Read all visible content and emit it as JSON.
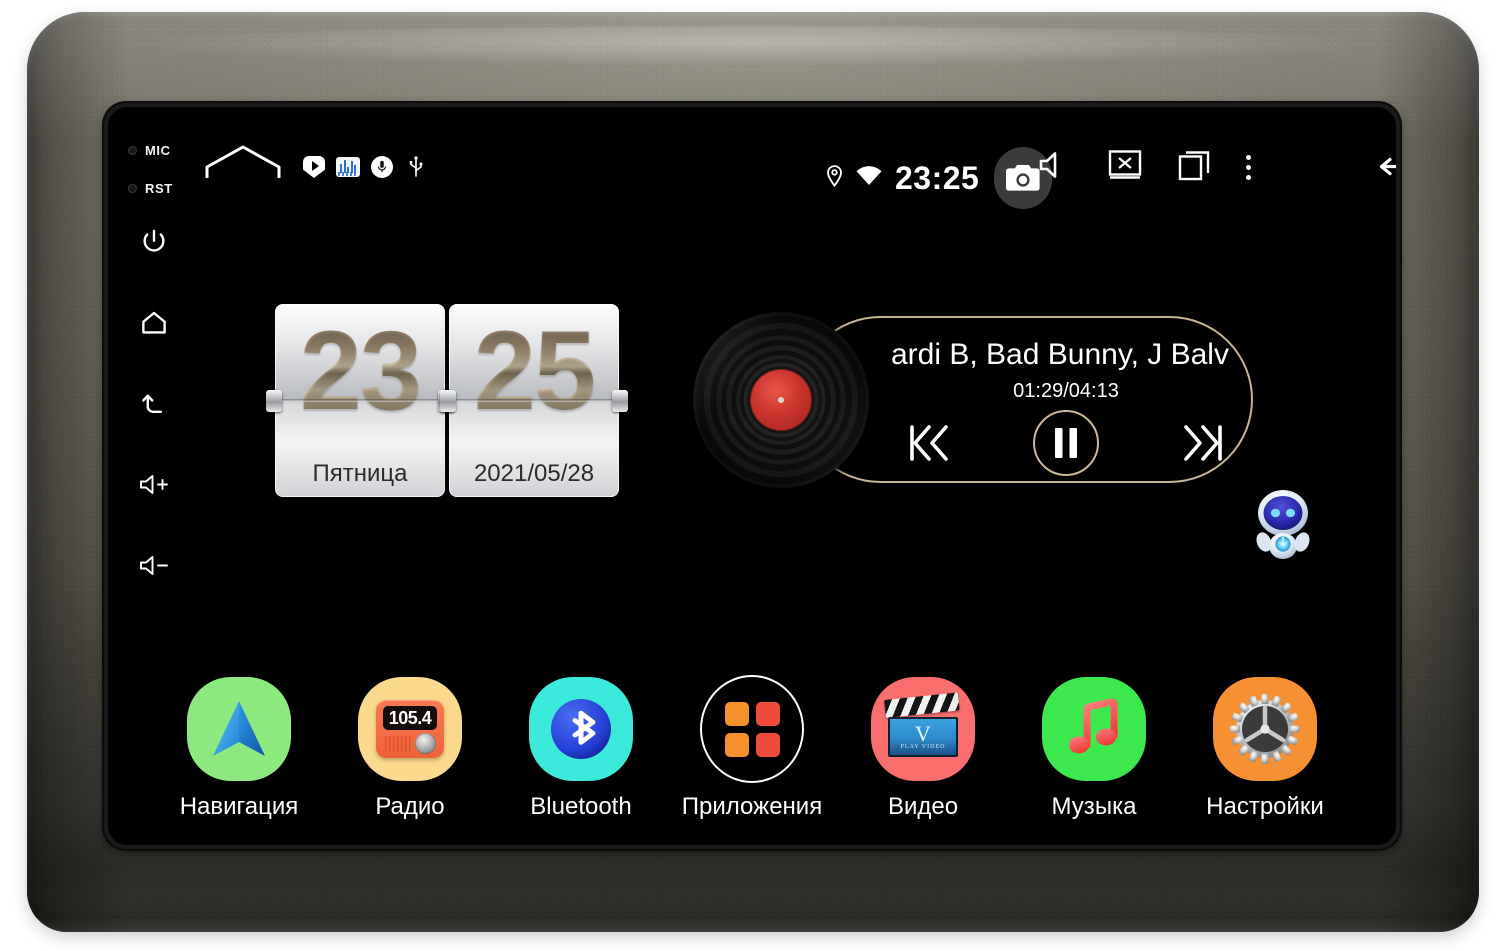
{
  "device": {
    "name": "Android car head unit",
    "bezel_color": "#6f6c61",
    "screen_bg": "#000000"
  },
  "indicators": [
    {
      "label": "MIC",
      "name": "mic-indicator"
    },
    {
      "label": "RST",
      "name": "reset-indicator"
    }
  ],
  "hardkeys": [
    {
      "icon": "power-icon",
      "label": "Power"
    },
    {
      "icon": "home-icon",
      "label": "Home"
    },
    {
      "icon": "back-icon",
      "label": "Back"
    },
    {
      "icon": "volume-up-icon",
      "label": "Volume +"
    },
    {
      "icon": "volume-down-icon",
      "label": "Volume -"
    }
  ],
  "statusbar": {
    "home_icon": "home-outline-icon",
    "notifications": [
      {
        "icon": "play-shield-icon",
        "label": "Player"
      },
      {
        "icon": "equalizer-icon",
        "label": "MP3 equalizer"
      },
      {
        "icon": "microphone-icon",
        "label": "Voice assistant"
      },
      {
        "icon": "usb-icon",
        "label": "USB connected"
      }
    ],
    "location_icon": "location-pin-icon",
    "wifi_icon": "wifi-icon",
    "time": "23:25",
    "camera_icon": "camera-icon",
    "camera_active": true,
    "volume_icon": "speaker-mute-icon",
    "screen_off_icon": "screen-off-icon",
    "recents_icon": "recent-apps-icon",
    "overflow_icon": "more-vertical-icon",
    "back_icon": "back-arrow-icon"
  },
  "clock_widget": {
    "hours": "23",
    "minutes": "25",
    "weekday": "Пятница",
    "date": "2021/05/28"
  },
  "player_widget": {
    "album_art": "vinyl-record",
    "track_title": "ardi B, Bad Bunny, J Balv",
    "elapsed": "01:29",
    "duration": "04:13",
    "time_display": "01:29/04:13",
    "prev_icon": "previous-track-icon",
    "play_pause_icon": "pause-icon",
    "next_icon": "next-track-icon",
    "state": "playing",
    "accent_color": "#c8b496"
  },
  "assistant": {
    "icon": "robot-assistant-icon",
    "label": "Voice assistant robot"
  },
  "dock": {
    "apps": [
      {
        "label": "Навигация",
        "icon": "navigation-icon",
        "bg": "#8ce87f",
        "name": "app-navigation"
      },
      {
        "label": "Радио",
        "icon": "radio-icon",
        "bg": "#fbd98d",
        "name": "app-radio",
        "frequency": "105.4"
      },
      {
        "label": "Bluetooth",
        "icon": "bluetooth-icon",
        "bg": "#3ceadc",
        "name": "app-bluetooth"
      },
      {
        "label": "Приложения",
        "icon": "apps-grid-icon",
        "bg": "#000000",
        "name": "app-applications"
      },
      {
        "label": "Видео",
        "icon": "video-icon",
        "bg": "#fb6e6e",
        "name": "app-video"
      },
      {
        "label": "Музыка",
        "icon": "music-note-icon",
        "bg": "#3de84e",
        "name": "app-music"
      },
      {
        "label": "Настройки",
        "icon": "settings-gear-icon",
        "bg": "#f79033",
        "name": "app-settings"
      }
    ]
  }
}
